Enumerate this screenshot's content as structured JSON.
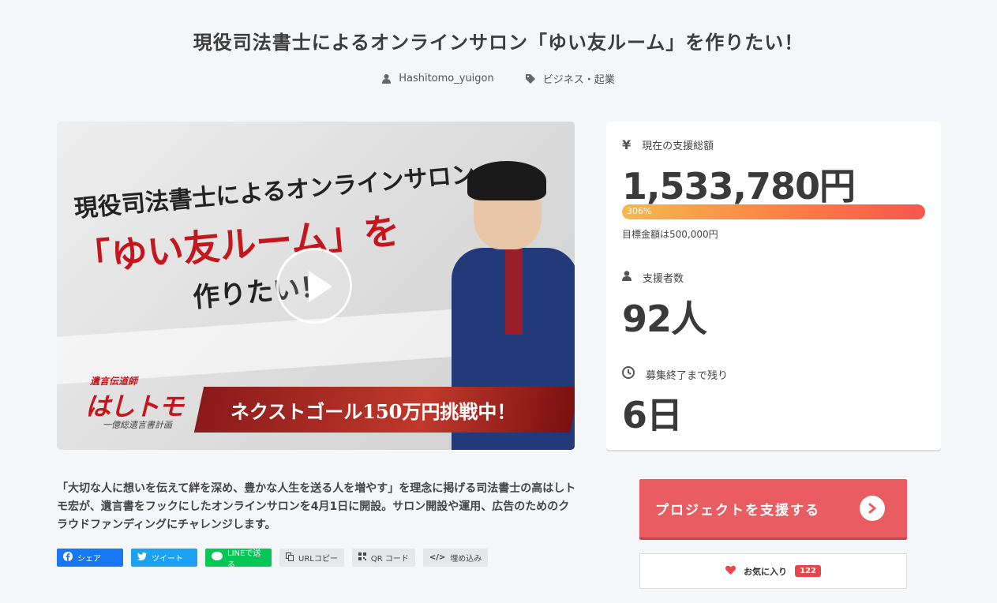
{
  "page": {
    "title": "現役司法書士によるオンラインサロン「ゆい友ルーム」を作りたい！",
    "author": "Hashitomo_yuigon",
    "category": "ビジネス・起業"
  },
  "video": {
    "line1": "現役司法書士によるオンラインサロン",
    "line2": "「ゆい友ルーム」を",
    "line3": "作りたい！",
    "ribbon": "ネクストゴール150万円挑戦中！",
    "logo_small": "遺言伝道師",
    "logo_big": "はしトモ",
    "logo_sub": "一億総遺言書計画"
  },
  "stats": {
    "amount_label": "現在の支援総額",
    "amount": "1,533,780円",
    "progress_label": "306%",
    "progress_percent": 306,
    "goal_text": "目標金額は500,000円",
    "backers_label": "支援者数",
    "backers": "92人",
    "remaining_label": "募集終了まで残り",
    "remaining": "6日"
  },
  "description": "「大切な人に想いを伝えて絆を深め、豊かな人生を送る人を増やす」を理念に掲げる司法書士の高はしトモ宏が、遺言書をフックにしたオンラインサロンを4月1日に開設。サロン開設や運用、広告のためのクラウドファンディングにチャレンジします。",
  "share": {
    "facebook": "シェア",
    "twitter": "ツイート",
    "line": "LINEで送る",
    "url_copy": "URLコピー",
    "qr": "QR コード",
    "embed": "埋め込み"
  },
  "actions": {
    "support_label": "プロジェクトを支援する",
    "favorite_label": "お気に入り",
    "favorite_count": "122"
  },
  "colors": {
    "accent": "#e85c62",
    "progress_start": "#f3b94d",
    "progress_end": "#f5564c",
    "facebook": "#1877f2",
    "twitter": "#1da1f2",
    "line": "#06c755"
  }
}
